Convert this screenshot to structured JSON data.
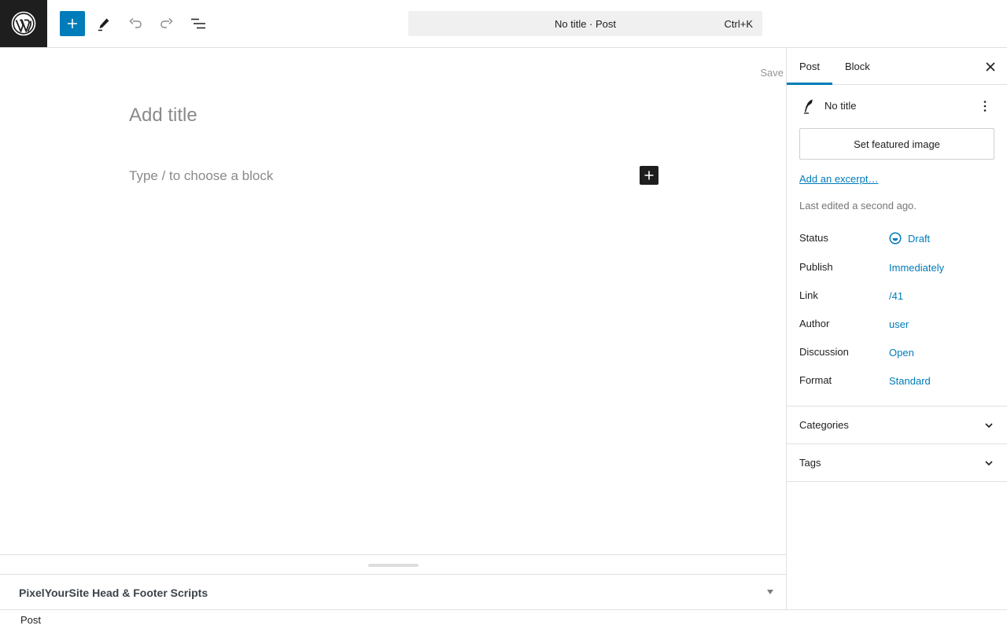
{
  "header": {
    "command_bar_title": "No title · Post",
    "command_bar_shortcut": "Ctrl+K"
  },
  "editor": {
    "save_label": "Save",
    "title_placeholder": "Add title",
    "block_placeholder": "Type / to choose a block"
  },
  "metabox": {
    "title": "PixelYourSite Head & Footer Scripts"
  },
  "footer": {
    "breadcrumb": "Post"
  },
  "sidebar": {
    "tabs": [
      {
        "label": "Post",
        "active": true
      },
      {
        "label": "Block",
        "active": false
      }
    ],
    "summary": {
      "post_title": "No title",
      "featured_image_button": "Set featured image",
      "excerpt_link": "Add an excerpt…",
      "last_edited": "Last edited a second ago."
    },
    "meta": [
      {
        "key": "Status",
        "value": "Draft"
      },
      {
        "key": "Publish",
        "value": "Immediately"
      },
      {
        "key": "Link",
        "value": "/41"
      },
      {
        "key": "Author",
        "value": "user"
      },
      {
        "key": "Discussion",
        "value": "Open"
      },
      {
        "key": "Format",
        "value": "Standard"
      }
    ],
    "panels": [
      {
        "label": "Categories"
      },
      {
        "label": "Tags"
      }
    ]
  },
  "colors": {
    "accent": "#007cba",
    "dark": "#1e1e1e",
    "border": "#e0e0e0",
    "muted": "#757575"
  }
}
